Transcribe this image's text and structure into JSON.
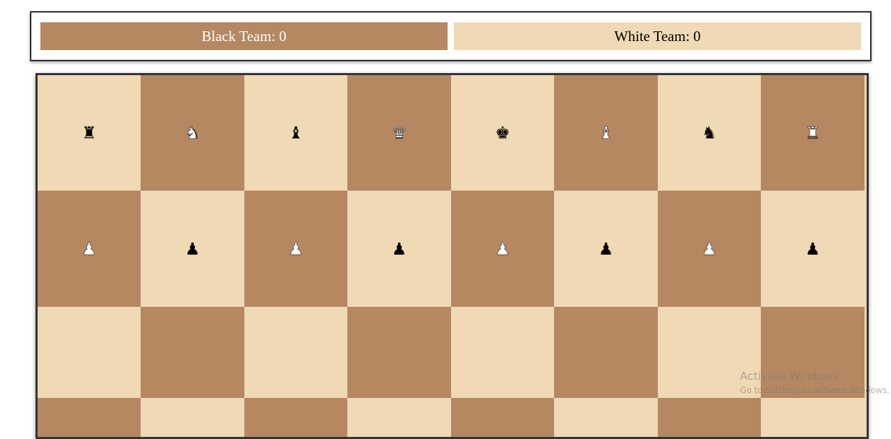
{
  "scoreboard": {
    "black_label": "Black Team: 0",
    "white_label": "White Team: 0"
  },
  "colors": {
    "light_square": "#f0d9b5",
    "dark_square": "#b58862"
  },
  "board": {
    "rows": [
      [
        {
          "piece": "♜",
          "name": "rook",
          "color": "black"
        },
        {
          "piece": "♞",
          "name": "knight",
          "color": "white"
        },
        {
          "piece": "♝",
          "name": "bishop",
          "color": "black"
        },
        {
          "piece": "♛",
          "name": "queen",
          "color": "white"
        },
        {
          "piece": "♚",
          "name": "king",
          "color": "black"
        },
        {
          "piece": "♝",
          "name": "bishop",
          "color": "white"
        },
        {
          "piece": "♞",
          "name": "knight",
          "color": "black"
        },
        {
          "piece": "♜",
          "name": "rook",
          "color": "white"
        }
      ],
      [
        {
          "piece": "♟",
          "name": "pawn",
          "color": "white"
        },
        {
          "piece": "♟",
          "name": "pawn",
          "color": "black"
        },
        {
          "piece": "♟",
          "name": "pawn",
          "color": "white"
        },
        {
          "piece": "♟",
          "name": "pawn",
          "color": "black"
        },
        {
          "piece": "♟",
          "name": "pawn",
          "color": "white"
        },
        {
          "piece": "♟",
          "name": "pawn",
          "color": "black"
        },
        {
          "piece": "♟",
          "name": "pawn",
          "color": "white"
        },
        {
          "piece": "♟",
          "name": "pawn",
          "color": "black"
        }
      ],
      [
        {
          "piece": "",
          "name": "empty",
          "color": ""
        },
        {
          "piece": "",
          "name": "empty",
          "color": ""
        },
        {
          "piece": "",
          "name": "empty",
          "color": ""
        },
        {
          "piece": "",
          "name": "empty",
          "color": ""
        },
        {
          "piece": "",
          "name": "empty",
          "color": ""
        },
        {
          "piece": "",
          "name": "empty",
          "color": ""
        },
        {
          "piece": "",
          "name": "empty",
          "color": ""
        },
        {
          "piece": "",
          "name": "empty",
          "color": ""
        }
      ],
      [
        {
          "piece": "",
          "name": "empty",
          "color": ""
        },
        {
          "piece": "",
          "name": "empty",
          "color": ""
        },
        {
          "piece": "",
          "name": "empty",
          "color": ""
        },
        {
          "piece": "",
          "name": "empty",
          "color": ""
        },
        {
          "piece": "",
          "name": "empty",
          "color": ""
        },
        {
          "piece": "",
          "name": "empty",
          "color": ""
        },
        {
          "piece": "",
          "name": "empty",
          "color": ""
        },
        {
          "piece": "",
          "name": "empty",
          "color": ""
        }
      ]
    ]
  },
  "watermark": {
    "title": "Activate Windows",
    "subtitle": "Go to Settings to activate Windows."
  }
}
